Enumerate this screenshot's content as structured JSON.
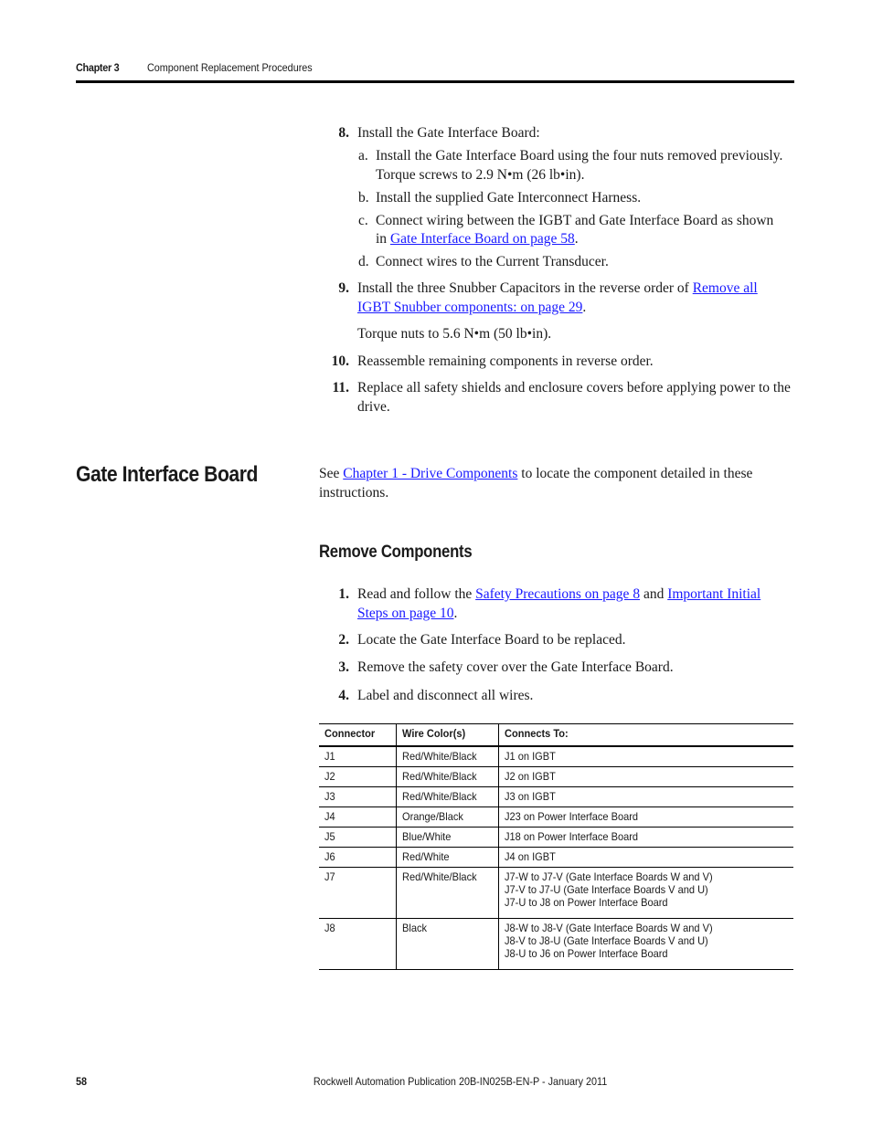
{
  "header": {
    "chapter": "Chapter 3",
    "title": "Component Replacement Procedures"
  },
  "install_steps": {
    "step8": {
      "num": "8.",
      "text": "Install the Gate Interface Board:",
      "substeps": [
        {
          "letter": "a.",
          "line1": "Install the Gate Interface Board using the four nuts removed previously.",
          "line2": "Torque screws to 2.9 N•m (26 lb•in)."
        },
        {
          "letter": "b.",
          "text": "Install the supplied Gate Interconnect Harness."
        },
        {
          "letter": "c.",
          "line1": "Connect wiring between the IGBT and Gate Interface Board as shown",
          "line2_prefix": "in ",
          "link": "Gate Interface Board on page 58",
          "line2_suffix": "."
        },
        {
          "letter": "d.",
          "text": "Connect wires to the Current Transducer."
        }
      ]
    },
    "step9": {
      "num": "9.",
      "prefix": "Install the three Snubber Capacitors in the reverse order of ",
      "link_line1": "Remove all",
      "link_line2": "IGBT Snubber components: on page 29",
      "suffix": ".",
      "note": "Torque nuts to 5.6 N•m (50 lb•in)."
    },
    "step10": {
      "num": "10.",
      "text": "Reassemble remaining components in reverse order."
    },
    "step11": {
      "num": "11.",
      "line1": "Replace all safety shields and enclosure covers before applying power to the",
      "line2": "drive."
    }
  },
  "section": {
    "title": "Gate Interface Board",
    "intro_prefix": "See ",
    "intro_link": "Chapter 1 - Drive Components",
    "intro_suffix": " to locate the component detailed in these",
    "intro_line2": "instructions.",
    "subtitle": "Remove Components"
  },
  "remove_steps": {
    "step1": {
      "num": "1.",
      "prefix": "Read and follow the ",
      "link1": "Safety Precautions on page 8",
      "middle": " and ",
      "link2_line1": "Important Initial",
      "link2_line2": "Steps on page 10",
      "suffix": "."
    },
    "step2": {
      "num": "2.",
      "text": "Locate the Gate Interface Board to be replaced."
    },
    "step3": {
      "num": "3.",
      "text": "Remove the safety cover over the Gate Interface Board."
    },
    "step4": {
      "num": "4.",
      "text": "Label and disconnect all wires."
    }
  },
  "table": {
    "headers": [
      "Connector",
      "Wire Color(s)",
      "Connects To:"
    ],
    "rows": [
      {
        "connector": "J1",
        "color": "Red/White/Black",
        "to": [
          "J1 on IGBT"
        ]
      },
      {
        "connector": "J2",
        "color": "Red/White/Black",
        "to": [
          "J2 on IGBT"
        ]
      },
      {
        "connector": "J3",
        "color": "Red/White/Black",
        "to": [
          "J3 on IGBT"
        ]
      },
      {
        "connector": "J4",
        "color": "Orange/Black",
        "to": [
          "J23 on Power Interface Board"
        ]
      },
      {
        "connector": "J5",
        "color": "Blue/White",
        "to": [
          "J18 on Power Interface Board"
        ]
      },
      {
        "connector": "J6",
        "color": "Red/White",
        "to": [
          "J4 on IGBT"
        ]
      },
      {
        "connector": "J7",
        "color": "Red/White/Black",
        "to": [
          "J7-W to J7-V (Gate Interface Boards W and V)",
          "J7-V to J7-U (Gate Interface Boards V and U)",
          "J7-U to J8 on Power Interface Board"
        ]
      },
      {
        "connector": "J8",
        "color": "Black",
        "to": [
          "J8-W to J8-V (Gate Interface Boards W and V)",
          "J8-V to J8-U (Gate Interface Boards V and U)",
          "J8-U to J6 on Power Interface Board"
        ]
      }
    ]
  },
  "footer": {
    "page_number": "58",
    "publication": "Rockwell Automation Publication 20B-IN025B-EN-P - January 2011"
  }
}
